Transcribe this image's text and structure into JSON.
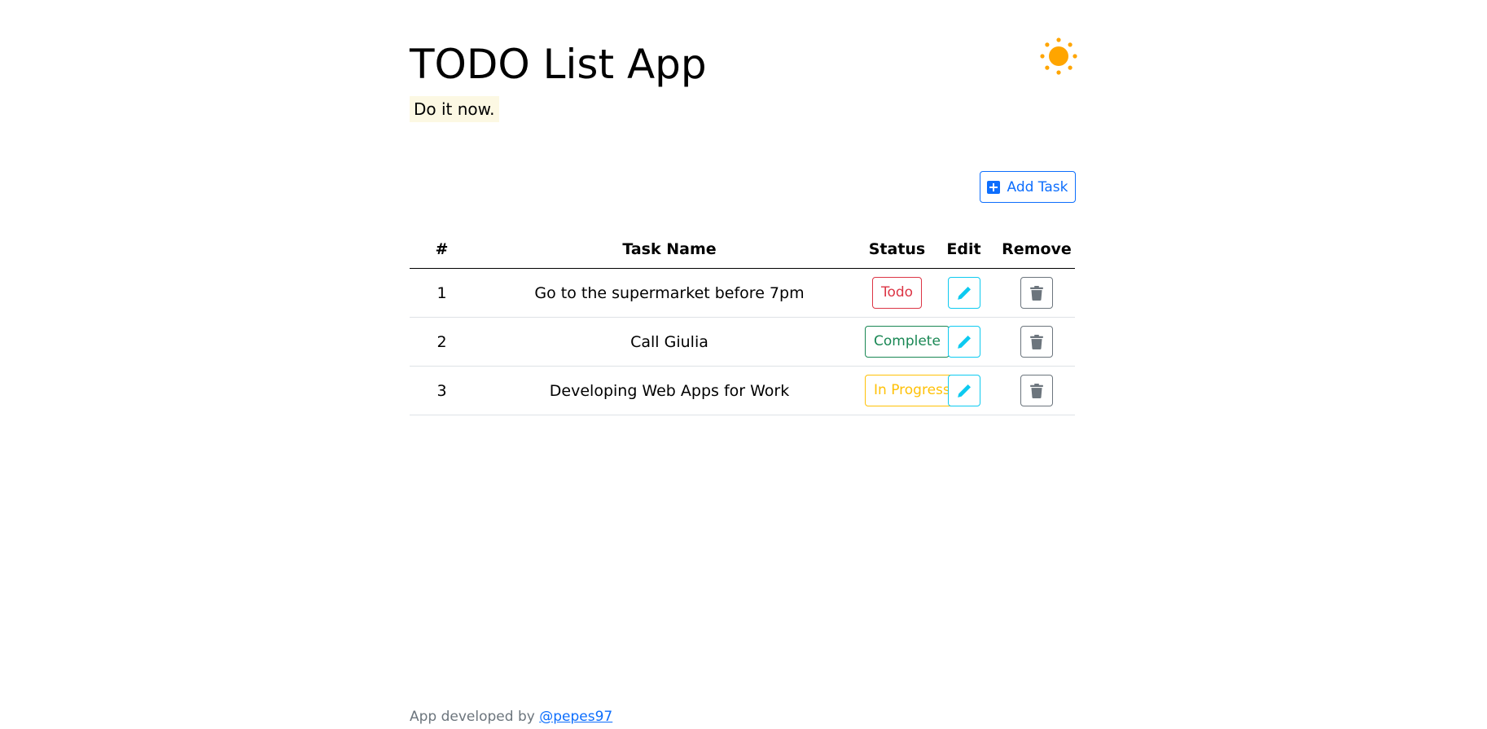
{
  "header": {
    "title": "TODO List App",
    "subtitle": "Do it now.",
    "theme_icon": "sun-icon",
    "theme_color": "#ffa500"
  },
  "toolbar": {
    "add_task_label": "Add Task",
    "add_icon": "plus-square-icon"
  },
  "table": {
    "columns": [
      "#",
      "Task Name",
      "Status",
      "Edit",
      "Remove"
    ],
    "rows": [
      {
        "index": "1",
        "name": "Go to the supermarket before 7pm",
        "status": "Todo",
        "status_color": "#dc3545"
      },
      {
        "index": "2",
        "name": "Call Giulia",
        "status": "Complete",
        "status_color": "#198754"
      },
      {
        "index": "3",
        "name": "Developing Web Apps for Work",
        "status": "In Progress",
        "status_color": "#ffc107"
      }
    ],
    "edit_icon": "pencil-icon",
    "remove_icon": "trash-icon"
  },
  "footer": {
    "text": "App developed by",
    "link_label": "@pepes97"
  },
  "colors": {
    "primary": "#0d6efd",
    "info": "#0dcaf0",
    "secondary": "#6c757d"
  }
}
